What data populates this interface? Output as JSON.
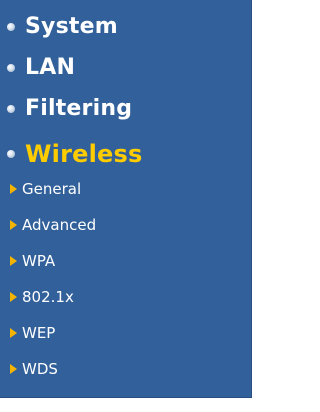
{
  "menu": {
    "main_items": [
      {
        "label": "System",
        "icon": "bullet-icon"
      },
      {
        "label": "LAN",
        "icon": "bullet-icon"
      },
      {
        "label": "Filtering",
        "icon": "bullet-icon"
      },
      {
        "label": "Wireless",
        "icon": "bullet-icon",
        "active": true
      }
    ],
    "wireless_sub_items": [
      {
        "label": "General",
        "icon": "arrow-right-icon"
      },
      {
        "label": "Advanced",
        "icon": "arrow-right-icon"
      },
      {
        "label": "WPA",
        "icon": "arrow-right-icon"
      },
      {
        "label": "802.1x",
        "icon": "arrow-right-icon"
      },
      {
        "label": "WEP",
        "icon": "arrow-right-icon"
      },
      {
        "label": "WDS",
        "icon": "arrow-right-icon"
      }
    ]
  },
  "colors": {
    "panel_background": "#31609a",
    "active_label": "#ffcc00",
    "label": "#ffffff",
    "arrow": "#f5b400"
  }
}
